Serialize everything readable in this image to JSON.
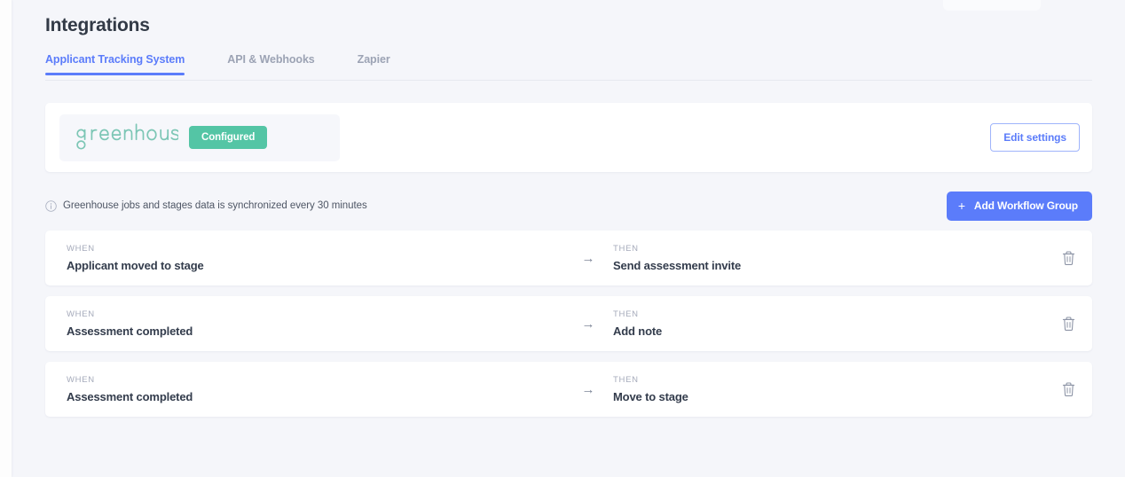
{
  "page": {
    "title": "Integrations"
  },
  "tabs": [
    {
      "label": "Applicant Tracking System",
      "active": true
    },
    {
      "label": "API & Webhooks",
      "active": false
    },
    {
      "label": "Zapier",
      "active": false
    }
  ],
  "integration": {
    "provider_name": "greenhouse",
    "status_badge": "Configured",
    "edit_button": "Edit settings"
  },
  "sync": {
    "icon": "info-icon",
    "message": "Greenhouse jobs and stages data is synchronized every 30 minutes",
    "add_button": "Add Workflow Group",
    "add_button_icon": "plus-icon"
  },
  "workflows": {
    "when_label": "WHEN",
    "then_label": "THEN",
    "arrow": "→",
    "delete_icon": "trash-icon",
    "rows": [
      {
        "when": "Applicant moved to stage",
        "then": "Send assessment invite"
      },
      {
        "when": "Assessment completed",
        "then": "Add note"
      },
      {
        "when": "Assessment completed",
        "then": "Move to stage"
      }
    ]
  },
  "colors": {
    "accent_blue": "#5b7cfa",
    "badge_green": "#54c5a5",
    "page_background": "#f5f6fa",
    "card_background": "#ffffff",
    "logo_teal": "#7cc6b5"
  }
}
